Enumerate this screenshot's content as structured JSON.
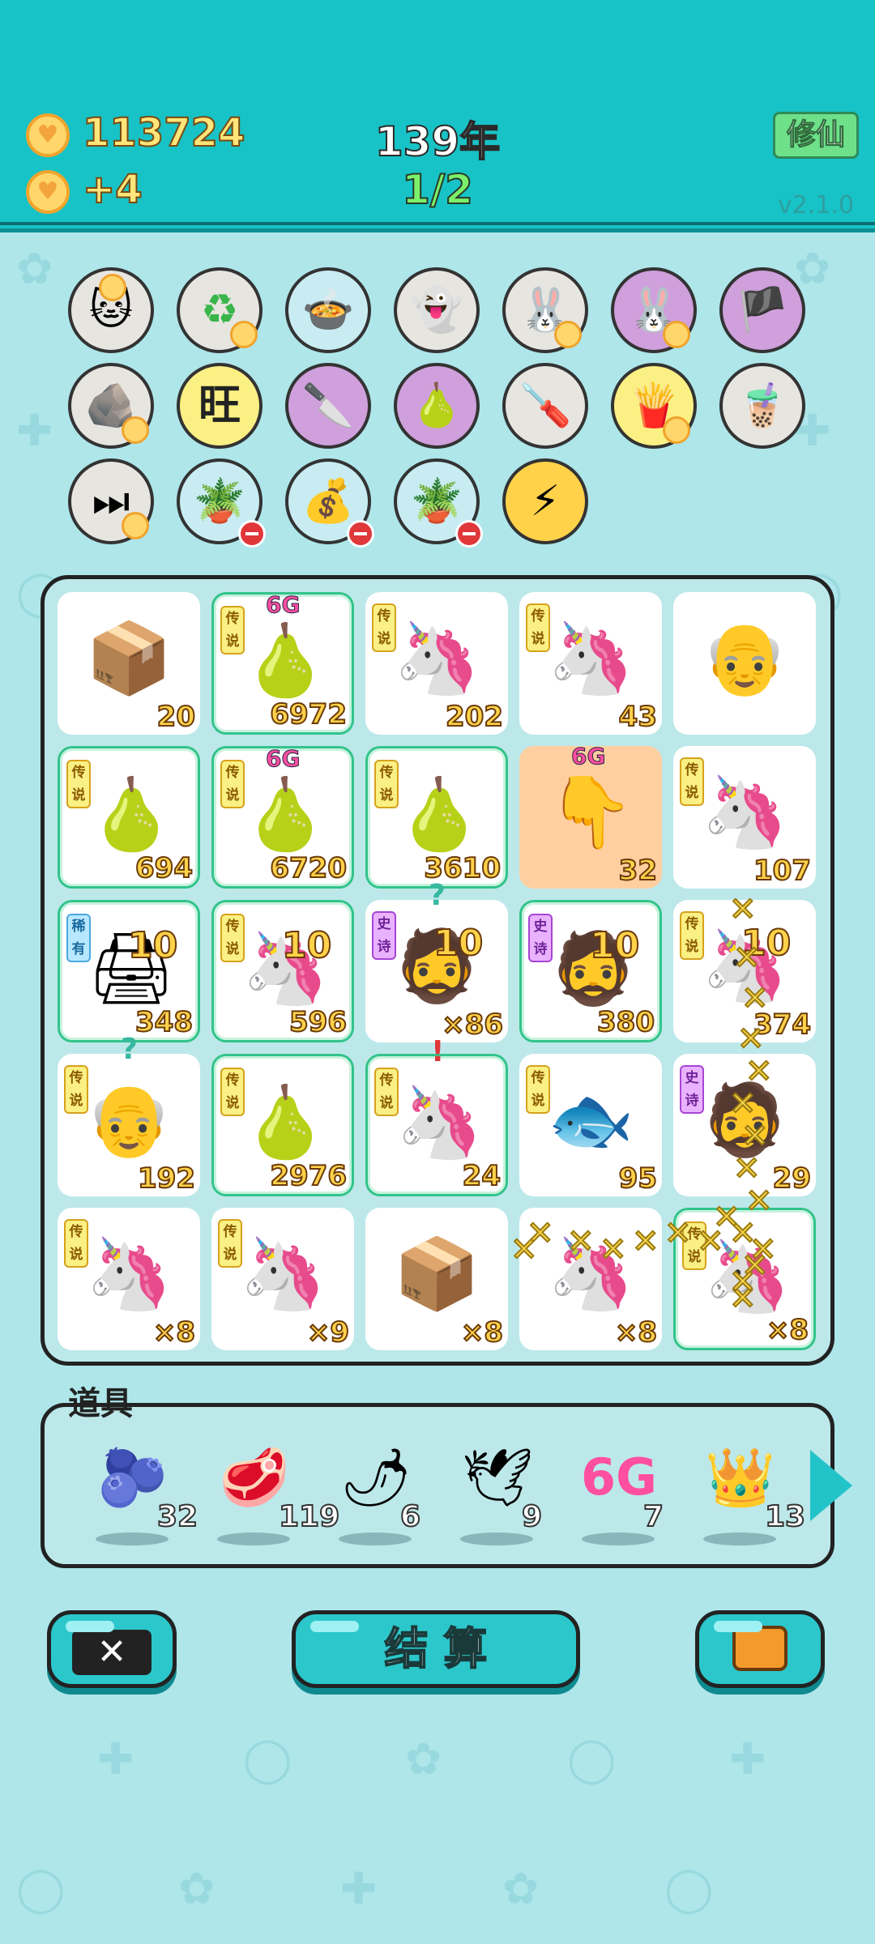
{
  "header": {
    "coins": "113724",
    "income": "+4",
    "year": "139年",
    "wave": "1/2",
    "cultivate_label": "修仙",
    "version": "v2.1.0"
  },
  "symbols_collection": [
    {
      "name": "cat-sunglasses",
      "glyph": "🐱"
    },
    {
      "name": "recycle",
      "glyph": "♻"
    },
    {
      "name": "pot-duck",
      "glyph": "🍲"
    },
    {
      "name": "ghost",
      "glyph": "👻"
    },
    {
      "name": "rabbit",
      "glyph": "🐰"
    },
    {
      "name": "rabbit-purple",
      "glyph": "🐰"
    },
    {
      "name": "eyepatch",
      "glyph": "🏴"
    },
    {
      "name": "stones",
      "glyph": "🪨"
    },
    {
      "name": "wang-text",
      "glyph": "旺"
    },
    {
      "name": "cleaver",
      "glyph": "🔪"
    },
    {
      "name": "pomelo-slice",
      "glyph": "🍐"
    },
    {
      "name": "screwdriver",
      "glyph": "🪛"
    },
    {
      "name": "fries",
      "glyph": "🍟"
    },
    {
      "name": "bubble-tea",
      "glyph": "🧋"
    },
    {
      "name": "skip",
      "glyph": "⏭"
    },
    {
      "name": "flower-pot",
      "glyph": "🪴"
    },
    {
      "name": "sack",
      "glyph": "💰"
    },
    {
      "name": "flower-pot-2",
      "glyph": "🪴"
    },
    {
      "name": "lightning",
      "glyph": "⚡"
    }
  ],
  "board": {
    "cells": [
      {
        "glyph": "📦",
        "count": "20"
      },
      {
        "glyph": "🍐",
        "count": "6972",
        "tag": "传说",
        "badge": "6G"
      },
      {
        "glyph": "🦄",
        "count": "202",
        "tag": "传说"
      },
      {
        "glyph": "🦄",
        "count": "43",
        "tag": "传说"
      },
      {
        "glyph": "👴",
        "count": ""
      },
      {
        "glyph": "🍐",
        "count": "694",
        "tag": "传说"
      },
      {
        "glyph": "🍐",
        "count": "6720",
        "tag": "传说",
        "badge": "6G"
      },
      {
        "glyph": "🍐",
        "count": "3610",
        "tag": "传说"
      },
      {
        "glyph": "👇",
        "count": "32",
        "badge": "6G"
      },
      {
        "glyph": "🦄",
        "count": "107",
        "tag": "传说"
      },
      {
        "glyph": "🖨",
        "count": "348",
        "tag": "稀有",
        "overlay": "10"
      },
      {
        "glyph": "🦄",
        "count": "596",
        "tag": "传说",
        "overlay": "10"
      },
      {
        "glyph": "🧔",
        "count": "×86",
        "tag": "史诗",
        "overlay": "10",
        "mark": "?"
      },
      {
        "glyph": "🧔",
        "count": "380",
        "tag": "史诗",
        "overlay": "10"
      },
      {
        "glyph": "🦄",
        "count": "374",
        "tag": "传说",
        "overlay": "10"
      },
      {
        "glyph": "👴",
        "count": "192",
        "tag": "传说",
        "mark": "?"
      },
      {
        "glyph": "🍐",
        "count": "2976",
        "tag": "传说"
      },
      {
        "glyph": "🦄",
        "count": "24",
        "tag": "传说",
        "mark": "!"
      },
      {
        "glyph": "🐟",
        "count": "95",
        "tag": "传说"
      },
      {
        "glyph": "🧔",
        "count": "29",
        "tag": "史诗"
      },
      {
        "glyph": "🦄",
        "count": "×8",
        "tag": "传说"
      },
      {
        "glyph": "🦄",
        "count": "×9",
        "tag": "传说"
      },
      {
        "glyph": "📦",
        "count": "×8"
      },
      {
        "glyph": "🦄",
        "count": "×8"
      },
      {
        "glyph": "🦄",
        "count": "×8",
        "tag": "传说"
      }
    ]
  },
  "items": {
    "title": "道具",
    "list": [
      {
        "name": "blueberry",
        "glyph": "🫐",
        "count": "32"
      },
      {
        "name": "liver",
        "glyph": "🥩",
        "count": "119"
      },
      {
        "name": "chili",
        "glyph": "🌶",
        "count": "6"
      },
      {
        "name": "pigeon",
        "glyph": "🕊",
        "count": "9"
      },
      {
        "name": "6g",
        "glyph": "6G",
        "count": "7"
      },
      {
        "name": "crown",
        "glyph": "👑",
        "count": "13"
      }
    ]
  },
  "buttons": {
    "settle_label": "结 算",
    "close_glyph": "✕"
  }
}
